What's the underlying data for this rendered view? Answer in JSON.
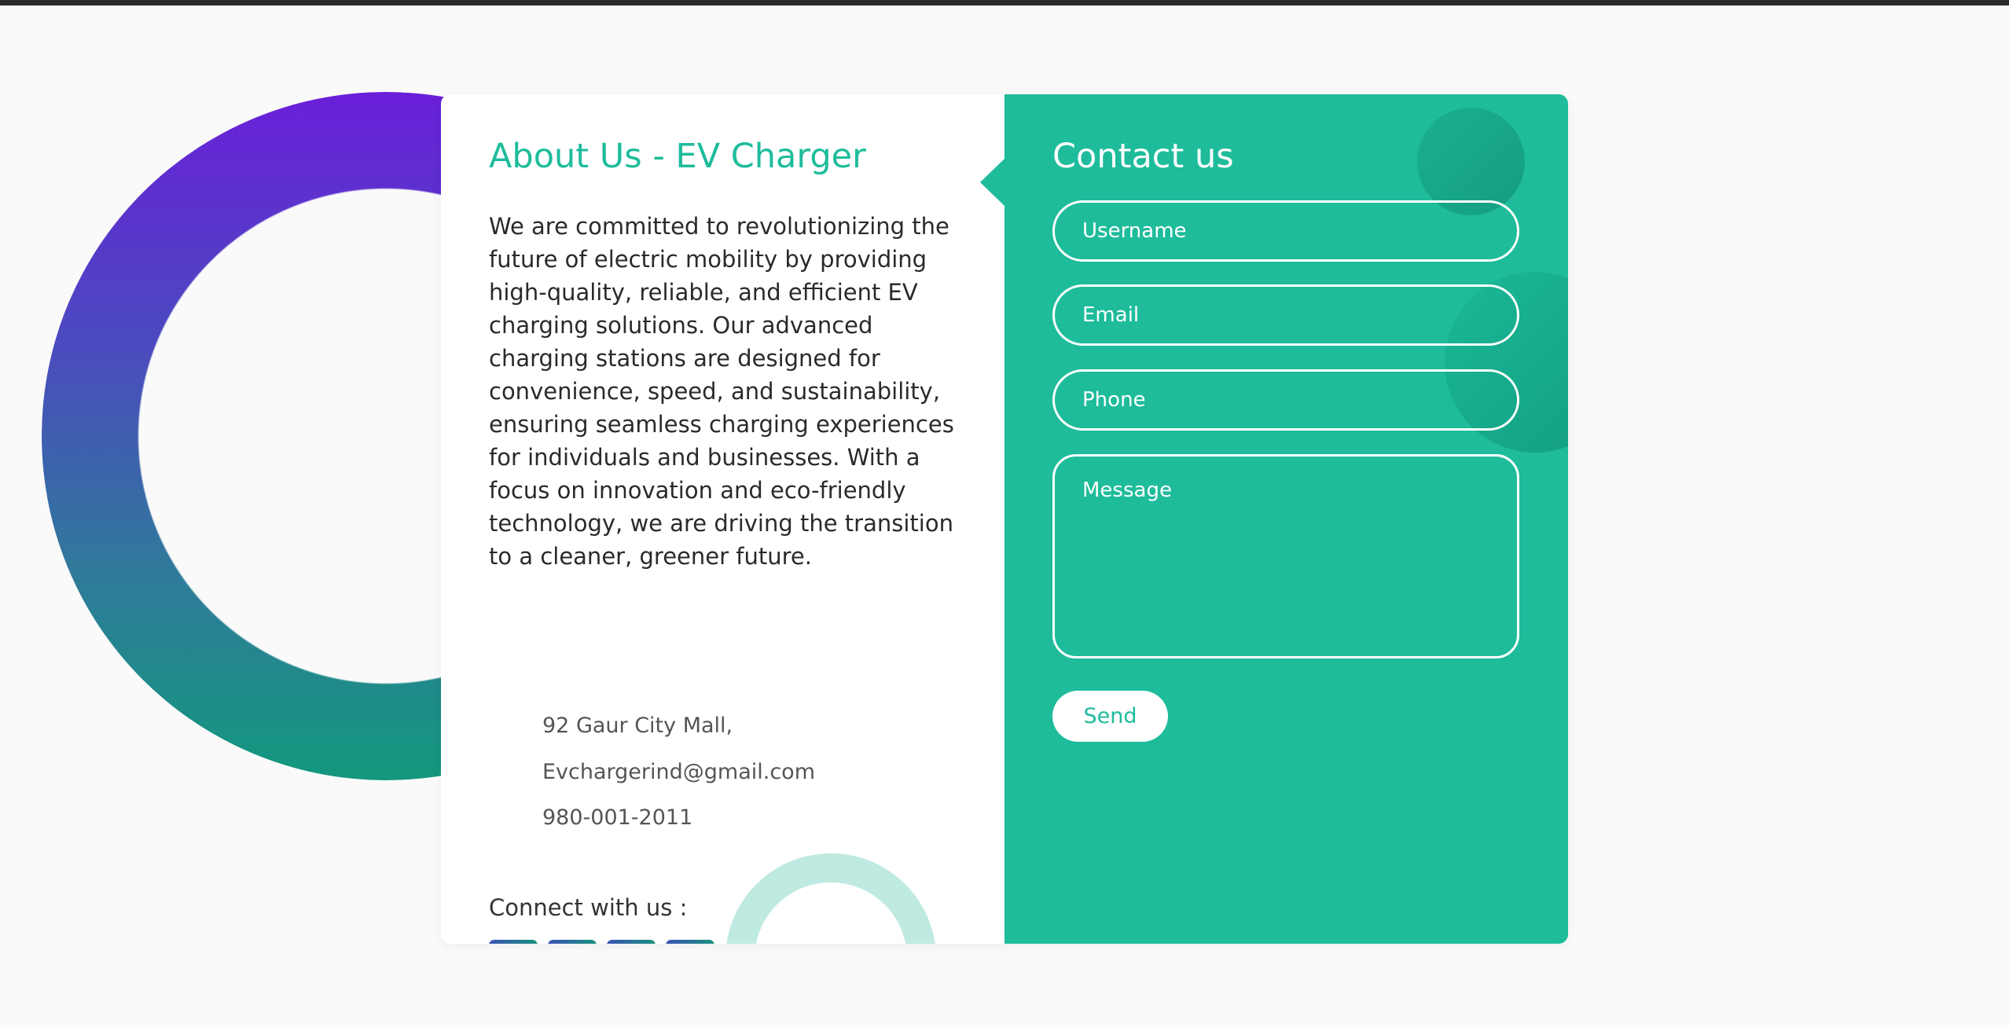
{
  "about": {
    "title": "About Us - EV Charger",
    "text": "We are committed to revolutionizing the future of electric mobility by providing high-quality, reliable, and efficient EV charging solutions. Our advanced charging stations are designed for convenience, speed, and sustainability, ensuring seamless charging experiences for individuals and businesses. With a focus on innovation and eco-friendly technology, we are driving the transition to a cleaner, greener future.",
    "address": "92 Gaur City Mall,",
    "email": "Evchargerind@gmail.com",
    "phone": "980-001-2011",
    "connect_label": "Connect with us :"
  },
  "contact": {
    "title": "Contact us",
    "username_placeholder": "Username",
    "email_placeholder": "Email",
    "phone_placeholder": "Phone",
    "message_placeholder": "Message",
    "send_label": "Send"
  },
  "colors": {
    "accent": "#1ebc9b",
    "ring_top": "#6a1fd9",
    "ring_bottom": "#13987d",
    "social_gradient_start": "#4a2fc4",
    "social_gradient_end": "#14937b",
    "light_ring": "#bfeae1"
  },
  "social_icons": [
    "social-icon-1",
    "social-icon-2",
    "social-icon-3",
    "social-icon-4"
  ]
}
